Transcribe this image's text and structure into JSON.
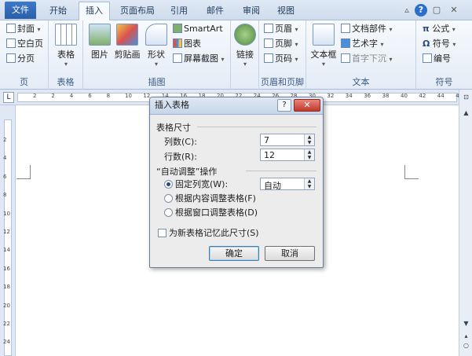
{
  "tabs": [
    {
      "label": "文件"
    },
    {
      "label": "开始"
    },
    {
      "label": "插入"
    },
    {
      "label": "页面布局"
    },
    {
      "label": "引用"
    },
    {
      "label": "邮件"
    },
    {
      "label": "审阅"
    },
    {
      "label": "视图"
    }
  ],
  "window_controls": {
    "minimize": "▵",
    "help": "?",
    "restore": "▢",
    "close": "✕"
  },
  "ribbon": {
    "pages": {
      "label": "页",
      "items": [
        "封面",
        "空白页",
        "分页"
      ]
    },
    "tables": {
      "label": "表格",
      "button": "表格"
    },
    "illustrations": {
      "label": "插图",
      "picture": "图片",
      "clipart": "剪贴画",
      "shapes": "形状",
      "smartart": "SmartArt",
      "chart": "图表",
      "screenshot": "屏幕截图"
    },
    "links": {
      "label": "链接",
      "button": "链接"
    },
    "header_footer": {
      "label": "页眉和页脚",
      "items": [
        "页眉",
        "页脚",
        "页码"
      ]
    },
    "text": {
      "label": "文本",
      "textbox": "文本框",
      "items": [
        "文档部件",
        "艺术字",
        "首字下沉"
      ]
    },
    "symbols": {
      "label": "符号",
      "items": [
        "公式",
        "符号",
        "编号"
      ]
    }
  },
  "ruler": {
    "top_marks": [
      "2",
      "2",
      "4",
      "6",
      "8",
      "10",
      "12",
      "14",
      "16",
      "18",
      "20",
      "22",
      "24",
      "26",
      "28",
      "30",
      "32",
      "34",
      "36",
      "38",
      "40",
      "42",
      "44",
      "46"
    ],
    "left_marks": [
      "2",
      "4",
      "6",
      "8",
      "10",
      "12",
      "14",
      "16",
      "18",
      "20",
      "22",
      "24"
    ],
    "tab_selector": "L"
  },
  "dialog": {
    "title": "插入表格",
    "help_button": "?",
    "close_button": "✕",
    "size_section": "表格尺寸",
    "columns_label": "列数(C):",
    "columns_value": "7",
    "rows_label": "行数(R):",
    "rows_value": "12",
    "autofit_section": "“自动调整”操作",
    "fixed_width_label": "固定列宽(W):",
    "fixed_width_value": "自动",
    "fit_content_label": "根据内容调整表格(F)",
    "fit_window_label": "根据窗口调整表格(D)",
    "remember_label": "为新表格记忆此尺寸(S)",
    "ok_label": "确定",
    "cancel_label": "取消",
    "selected_option": "fixed_width"
  },
  "scrollbar": {
    "up": "▲",
    "down": "▼",
    "prev": "▴",
    "next": "▾",
    "select": "○"
  }
}
